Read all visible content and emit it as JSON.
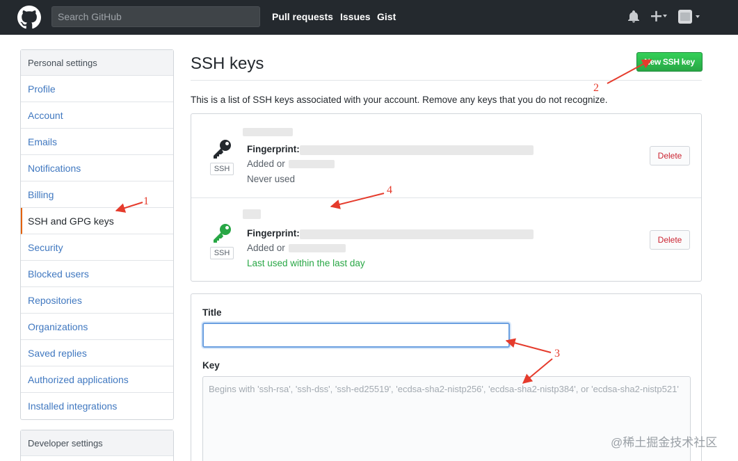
{
  "header": {
    "search_placeholder": "Search GitHub",
    "nav": [
      "Pull requests",
      "Issues",
      "Gist"
    ]
  },
  "sidebar": {
    "heading": "Personal settings",
    "items": [
      {
        "label": "Profile"
      },
      {
        "label": "Account"
      },
      {
        "label": "Emails"
      },
      {
        "label": "Notifications"
      },
      {
        "label": "Billing"
      },
      {
        "label": "SSH and GPG keys",
        "selected": true
      },
      {
        "label": "Security"
      },
      {
        "label": "Blocked users"
      },
      {
        "label": "Repositories"
      },
      {
        "label": "Organizations"
      },
      {
        "label": "Saved replies"
      },
      {
        "label": "Authorized applications"
      },
      {
        "label": "Installed integrations"
      }
    ],
    "developer_heading": "Developer settings"
  },
  "main": {
    "title": "SSH keys",
    "new_key_button": "New SSH key",
    "intro": "This is a list of SSH keys associated with your account. Remove any keys that you do not recognize.",
    "keys": [
      {
        "badge": "SSH",
        "fingerprint_label": "Fingerprint:",
        "added_label": "Added or",
        "usage": "Never used",
        "icon_color": "#24292e",
        "delete_label": "Delete"
      },
      {
        "badge": "SSH",
        "fingerprint_label": "Fingerprint:",
        "added_label": "Added or",
        "usage": "Last used within the last day",
        "icon_color": "#28a745",
        "delete_label": "Delete"
      }
    ],
    "form": {
      "title_label": "Title",
      "title_value": "",
      "key_label": "Key",
      "key_placeholder": "Begins with 'ssh-rsa', 'ssh-dss', 'ssh-ed25519', 'ecdsa-sha2-nistp256', 'ecdsa-sha2-nistp384', or 'ecdsa-sha2-nistp521'"
    }
  },
  "annotations": [
    "1",
    "2",
    "3",
    "4"
  ],
  "watermark": "@稀土掘金技术社区",
  "colors": {
    "header_bg": "#24292e",
    "link": "#4078c0",
    "selected_accent": "#e36209",
    "primary_button": "#28a745",
    "danger": "#cb2431",
    "annotation": "#e53b2c"
  }
}
